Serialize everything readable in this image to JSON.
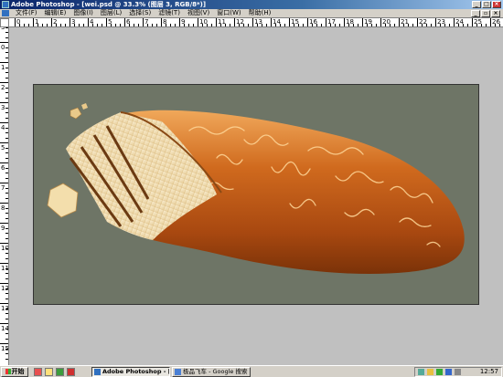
{
  "window": {
    "title": "Adobe Photoshop - [wei.psd @ 33.3% (图层 3, RGB/8*)]"
  },
  "menu": {
    "items": [
      "文件(F)",
      "编辑(E)",
      "图像(I)",
      "图层(L)",
      "选择(S)",
      "滤镜(T)",
      "视图(V)",
      "窗口(W)",
      "帮助(H)"
    ]
  },
  "ruler": {
    "h_labels": [
      "0",
      "1",
      "2",
      "3",
      "4",
      "5",
      "6",
      "7",
      "8",
      "9",
      "10",
      "11",
      "12",
      "13",
      "14",
      "15",
      "16",
      "17",
      "18",
      "19",
      "20",
      "21",
      "22",
      "23",
      "24",
      "25",
      "26"
    ],
    "v_labels": [
      "3",
      "0",
      "1",
      "2",
      "3",
      "4",
      "5",
      "6",
      "7",
      "8",
      "9",
      "10",
      "11",
      "12",
      "13",
      "14",
      "15"
    ]
  },
  "taskbar": {
    "start_label": "开始",
    "tasks": [
      "Adobe Photoshop - [w...",
      "极品飞车 - Google 搜索 ..."
    ],
    "clock": "12:57"
  },
  "colors": {
    "canvas_bg": "#6e7566",
    "workspace_bg": "#c0c0c0",
    "title_blue": "#0a246a"
  },
  "icons": [
    "photoshop-icon",
    "minimize-icon",
    "maximize-icon",
    "close-icon",
    "windows-flag-icon",
    "network-icon",
    "volume-icon"
  ]
}
